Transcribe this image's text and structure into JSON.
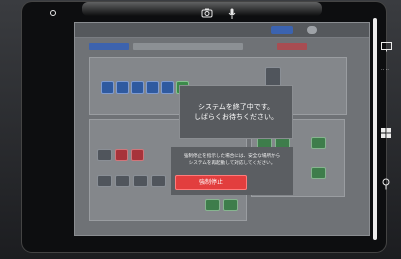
{
  "device_topbar": {
    "camera_icon": "camera-icon",
    "mic_icon": "microphone-icon"
  },
  "notice": {
    "line1": "システムを終了中です。",
    "line2": "しばらくお待ちください。"
  },
  "warning": {
    "line1": "強制停止を指示した場合には、安全な場所から",
    "line2": "システムを再起動して対応してください。"
  },
  "force_stop_button": {
    "label": "強制停止"
  },
  "colors": {
    "force_stop": "#e23e3e",
    "tile_blue": "#2f5aa0",
    "tile_green": "#3c8a4a"
  },
  "side_icons": [
    "monitor-icon",
    "windows-icon",
    "pen-icon"
  ]
}
